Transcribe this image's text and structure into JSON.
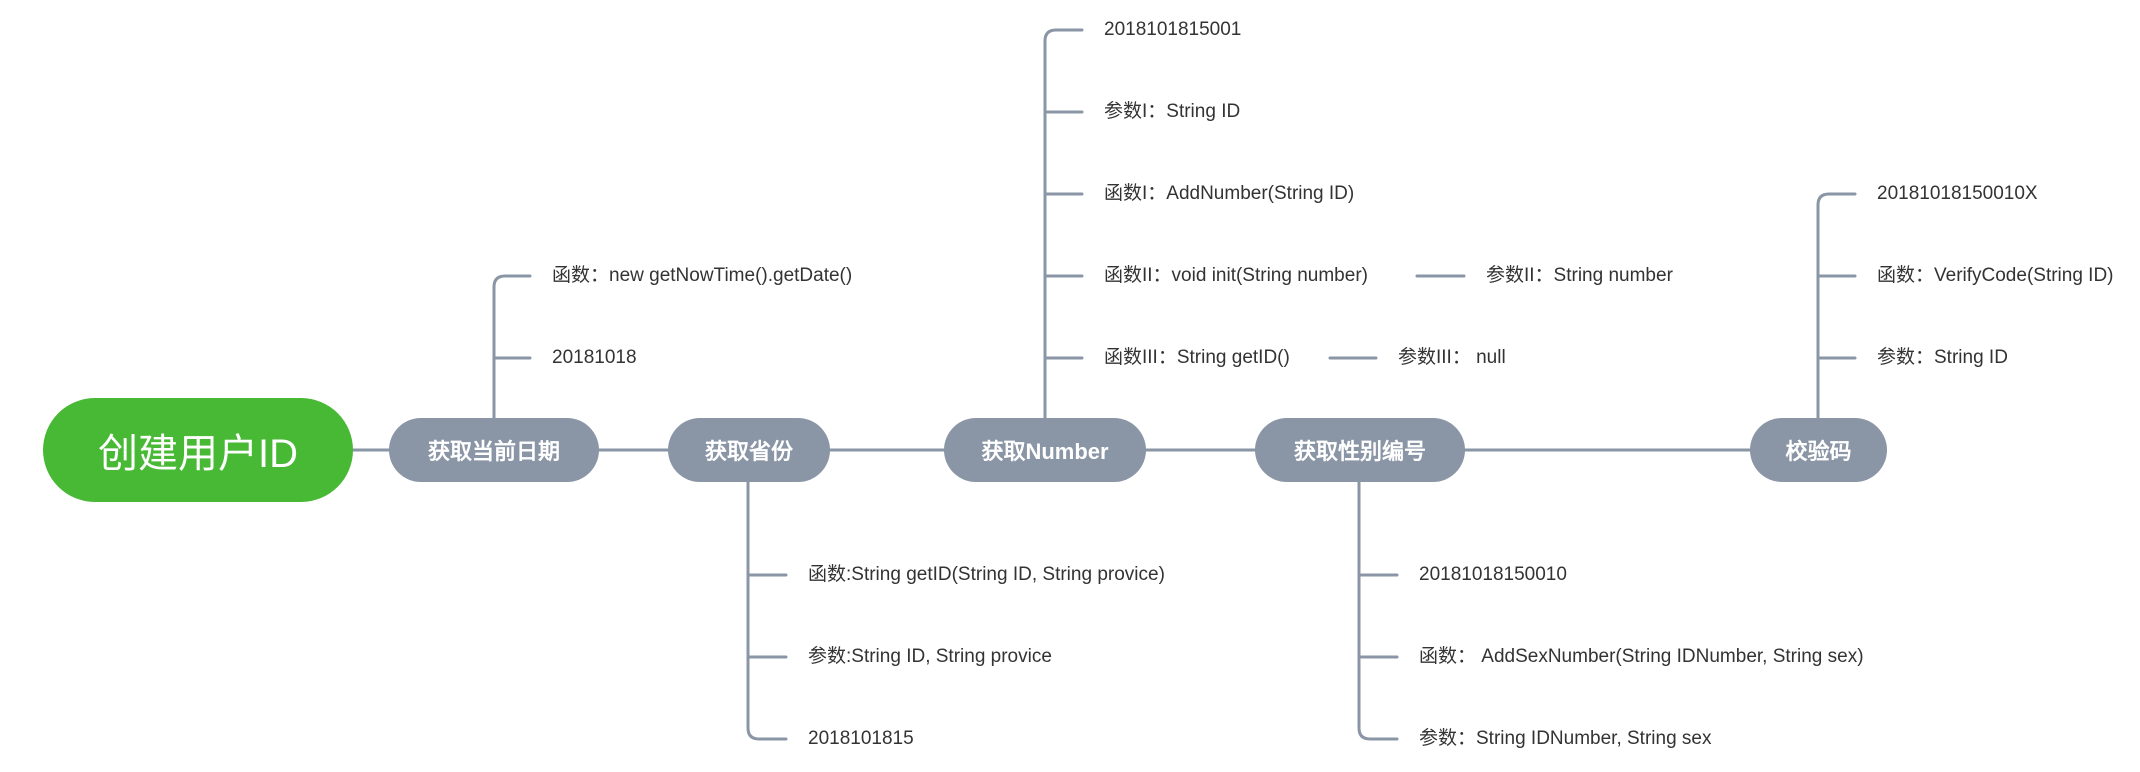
{
  "colors": {
    "root": "#47b934",
    "branch": "#8a95a5",
    "line": "#8a95a5",
    "leaf_text": "#333333"
  },
  "root": {
    "label": "创建用户ID"
  },
  "branches": [
    {
      "label": "获取当前日期",
      "leaves": [
        "函数：new getNowTime().getDate()",
        "20181018"
      ]
    },
    {
      "label": "获取省份",
      "leaves": [
        "函数:String getID(String ID, String provice)",
        "参数:String ID, String provice",
        "2018101815"
      ]
    },
    {
      "label": "获取Number",
      "leaves": [
        "2018101815001",
        "参数I：String ID",
        "函数I：AddNumber(String ID)",
        "函数II：void init(String number)",
        "函数III：String getID()"
      ],
      "sub_leaves": [
        "参数II：String number",
        "参数III： null"
      ]
    },
    {
      "label": "获取性别编号",
      "leaves": [
        "20181018150010",
        "函数： AddSexNumber(String IDNumber, String sex)",
        "参数：String IDNumber, String sex"
      ]
    },
    {
      "label": "校验码",
      "leaves": [
        "20181018150010X",
        "函数：VerifyCode(String ID)",
        "参数：String ID"
      ]
    }
  ]
}
